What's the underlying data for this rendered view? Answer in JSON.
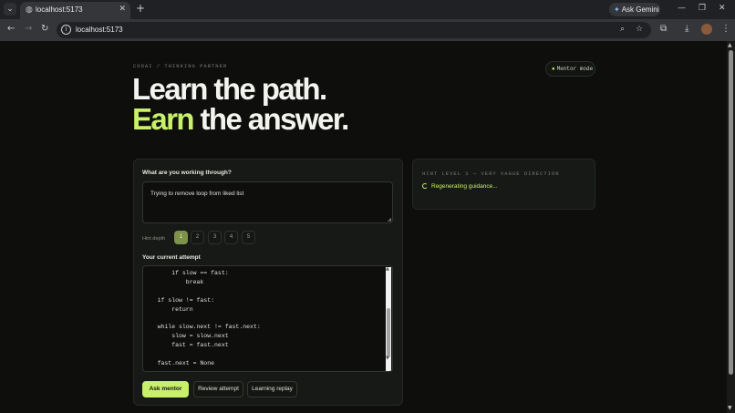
{
  "browser": {
    "tab_title": "localhost:5173",
    "url": "localhost:5173",
    "gemini_label": "Ask Gemini"
  },
  "header": {
    "eyebrow": "CODAI / THINKING PARTNER",
    "mentor_mode": "Mentor mode",
    "headline_line1": "Learn the path.",
    "headline_accent": "Earn",
    "headline_rest": " the answer."
  },
  "problem": {
    "label": "What are you working through?",
    "value": "Trying to remove loop from liked list"
  },
  "hint_depth": {
    "label": "Hint depth",
    "options": [
      "1",
      "2",
      "3",
      "4",
      "5"
    ],
    "selected": "1"
  },
  "attempt": {
    "label": "Your current attempt",
    "code_lines": [
      "        if slow == fast:",
      "            break",
      "",
      "    if slow != fast:",
      "        return",
      "",
      "    while slow.next != fast.next:",
      "        slow = slow.next",
      "        fast = fast.next",
      "",
      "    fast.next = None"
    ]
  },
  "actions": {
    "ask_mentor": "Ask mentor",
    "review_attempt": "Review attempt",
    "learning_replay": "Learning replay"
  },
  "guidance": {
    "hint_level": "HINT LEVEL 1 — VERY VAGUE DIRECTION",
    "status": "Regenerating guidance..."
  },
  "colors": {
    "accent": "#c8f06a",
    "background": "#0e0f0d",
    "card": "#171916"
  }
}
